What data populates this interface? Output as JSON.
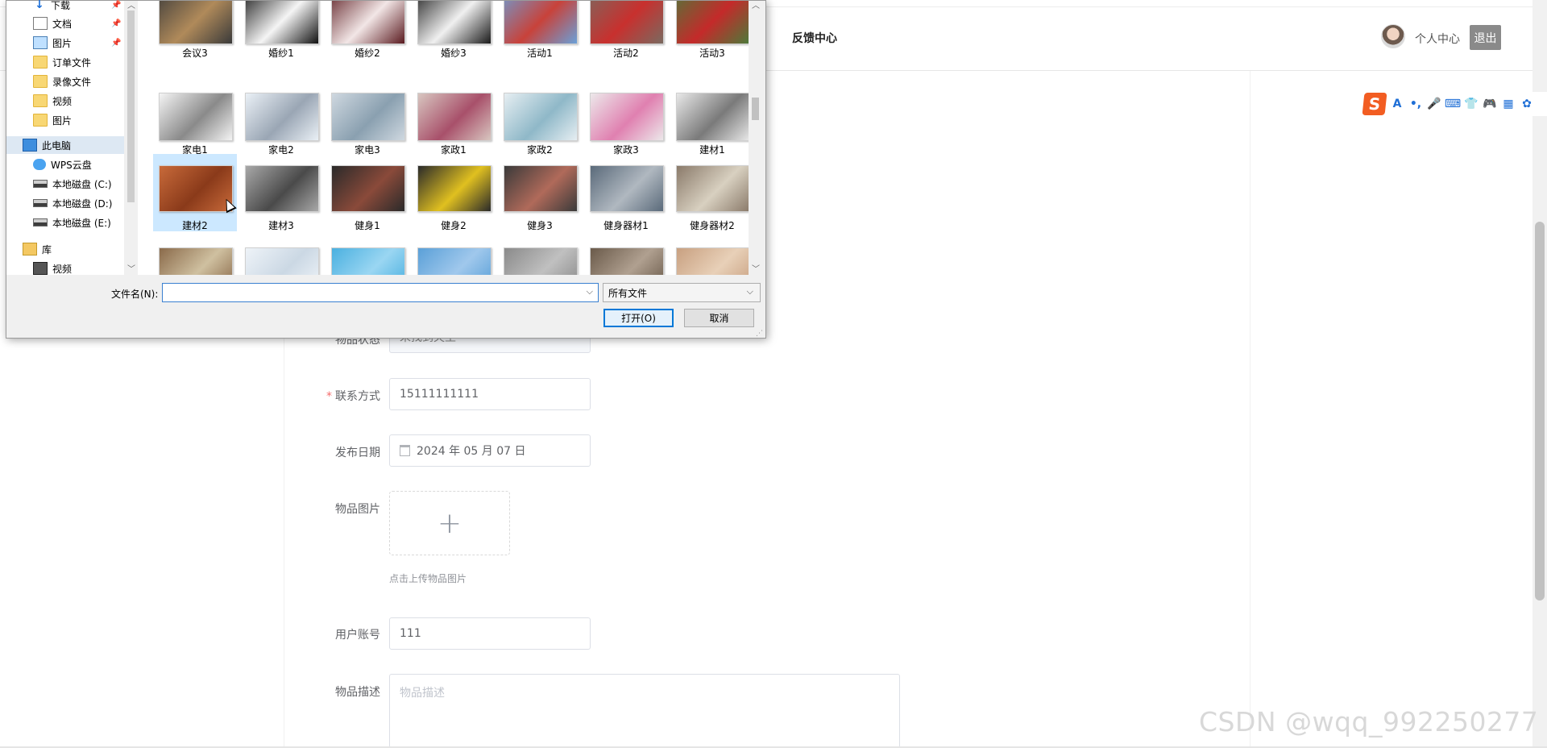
{
  "header": {
    "nav_feedback": "反馈中心",
    "user_center": "个人中心",
    "logout": "退出"
  },
  "ime_toolbar": {
    "logo": "S",
    "font_glyph": "A",
    "punct_glyph": "•,",
    "mic_glyph": "🎤",
    "keyboard_glyph": "⌨",
    "skin_glyph": "👕",
    "game_glyph": "🎮",
    "apps_glyph": "▦",
    "settings_glyph": "✿"
  },
  "form": {
    "status_label": "物品状态",
    "status_value": "未找到失主",
    "contact_label": "联系方式",
    "contact_value": "15111111111",
    "date_label": "发布日期",
    "date_value": "2024 年 05 月 07 日",
    "image_label": "物品图片",
    "upload_plus": "+",
    "upload_hint": "点击上传物品图片",
    "account_label": "用户账号",
    "account_value": "111",
    "desc_label": "物品描述",
    "desc_placeholder": "物品描述"
  },
  "watermark": "CSDN @wqq_992250277",
  "file_dialog": {
    "nav_items": [
      {
        "label": "下载",
        "icon": "download-icon",
        "pinned": true
      },
      {
        "label": "文档",
        "icon": "document-icon",
        "pinned": true
      },
      {
        "label": "图片",
        "icon": "picture-icon",
        "pinned": true
      },
      {
        "label": "订单文件",
        "icon": "folder-icon",
        "pinned": false
      },
      {
        "label": "录像文件",
        "icon": "folder-icon",
        "pinned": false
      },
      {
        "label": "视频",
        "icon": "folder-icon",
        "pinned": false
      },
      {
        "label": "图片",
        "icon": "folder-icon",
        "pinned": false
      },
      {
        "label": "此电脑",
        "icon": "computer-icon",
        "pinned": false
      },
      {
        "label": "WPS云盘",
        "icon": "cloud-icon",
        "pinned": false
      },
      {
        "label": "本地磁盘 (C:)",
        "icon": "drive-icon",
        "pinned": false
      },
      {
        "label": "本地磁盘 (D:)",
        "icon": "drive-icon",
        "pinned": false
      },
      {
        "label": "本地磁盘 (E:)",
        "icon": "drive-icon",
        "pinned": false
      },
      {
        "label": "库",
        "icon": "library-icon",
        "pinned": false
      },
      {
        "label": "视频",
        "icon": "video-icon",
        "pinned": false
      }
    ],
    "pin_glyph": "📌",
    "files": [
      {
        "name": "会议3",
        "colors": [
          "#3a3a3a",
          "#b08a5a"
        ]
      },
      {
        "name": "婚纱1",
        "colors": [
          "#111111",
          "#f5f5f5"
        ]
      },
      {
        "name": "婚纱2",
        "colors": [
          "#5a1a1f",
          "#f2e6e6"
        ]
      },
      {
        "name": "婚纱3",
        "colors": [
          "#1a1a1a",
          "#f0f0f0"
        ]
      },
      {
        "name": "活动1",
        "colors": [
          "#6aa0d8",
          "#c8423a"
        ]
      },
      {
        "name": "活动2",
        "colors": [
          "#7a6a60",
          "#c8302e"
        ]
      },
      {
        "name": "活动3",
        "colors": [
          "#4c7a3a",
          "#c42a2a"
        ]
      },
      {
        "name": "家电1",
        "colors": [
          "#f4f4f4",
          "#8a8a8a"
        ]
      },
      {
        "name": "家电2",
        "colors": [
          "#eaf0f6",
          "#9aa6b4"
        ]
      },
      {
        "name": "家电3",
        "colors": [
          "#cfd8e0",
          "#8aa0b0"
        ]
      },
      {
        "name": "家政1",
        "colors": [
          "#d8c6c0",
          "#a8506a"
        ]
      },
      {
        "name": "家政2",
        "colors": [
          "#e6eef2",
          "#8fb8c8"
        ]
      },
      {
        "name": "家政3",
        "colors": [
          "#ece8ea",
          "#e080b0"
        ]
      },
      {
        "name": "建材1",
        "colors": [
          "#e8e8e8",
          "#7a7a7a"
        ]
      },
      {
        "name": "建材2",
        "colors": [
          "#c86a3a",
          "#8a3a1a"
        ]
      },
      {
        "name": "建材3",
        "colors": [
          "#a8a8a8",
          "#4a4a4a"
        ]
      },
      {
        "name": "健身1",
        "colors": [
          "#2a2a2a",
          "#8a4a3a"
        ]
      },
      {
        "name": "健身2",
        "colors": [
          "#2a2a2a",
          "#e0c020"
        ]
      },
      {
        "name": "健身3",
        "colors": [
          "#3a3a3a",
          "#b06a5a"
        ]
      },
      {
        "name": "健身器材1",
        "colors": [
          "#5a6a7a",
          "#b0b8c0"
        ]
      },
      {
        "name": "健身器材2",
        "colors": [
          "#8a7a6a",
          "#d8d0c0"
        ]
      },
      {
        "name": "",
        "colors": [
          "#8a6a4a",
          "#cfc0a0"
        ]
      },
      {
        "name": "",
        "colors": [
          "#eef3f8",
          "#cbd8e4"
        ]
      },
      {
        "name": "",
        "colors": [
          "#4ab0e0",
          "#9ad6f2"
        ]
      },
      {
        "name": "",
        "colors": [
          "#5aa0d8",
          "#a0c8ec"
        ]
      },
      {
        "name": "",
        "colors": [
          "#8a8a8a",
          "#c0c0c0"
        ]
      },
      {
        "name": "",
        "colors": [
          "#6a5a4a",
          "#b0a090"
        ]
      },
      {
        "name": "",
        "colors": [
          "#c8a080",
          "#e8d0b8"
        ]
      }
    ],
    "selected_file": "建材2",
    "filename_label": "文件名(N):",
    "filename_value": "",
    "filetype_value": "所有文件",
    "open_button": "打开(O)",
    "cancel_button": "取消",
    "dropdown_glyph": "⌵",
    "scroll_up_glyph": "︿",
    "scroll_down_glyph": "﹀"
  }
}
